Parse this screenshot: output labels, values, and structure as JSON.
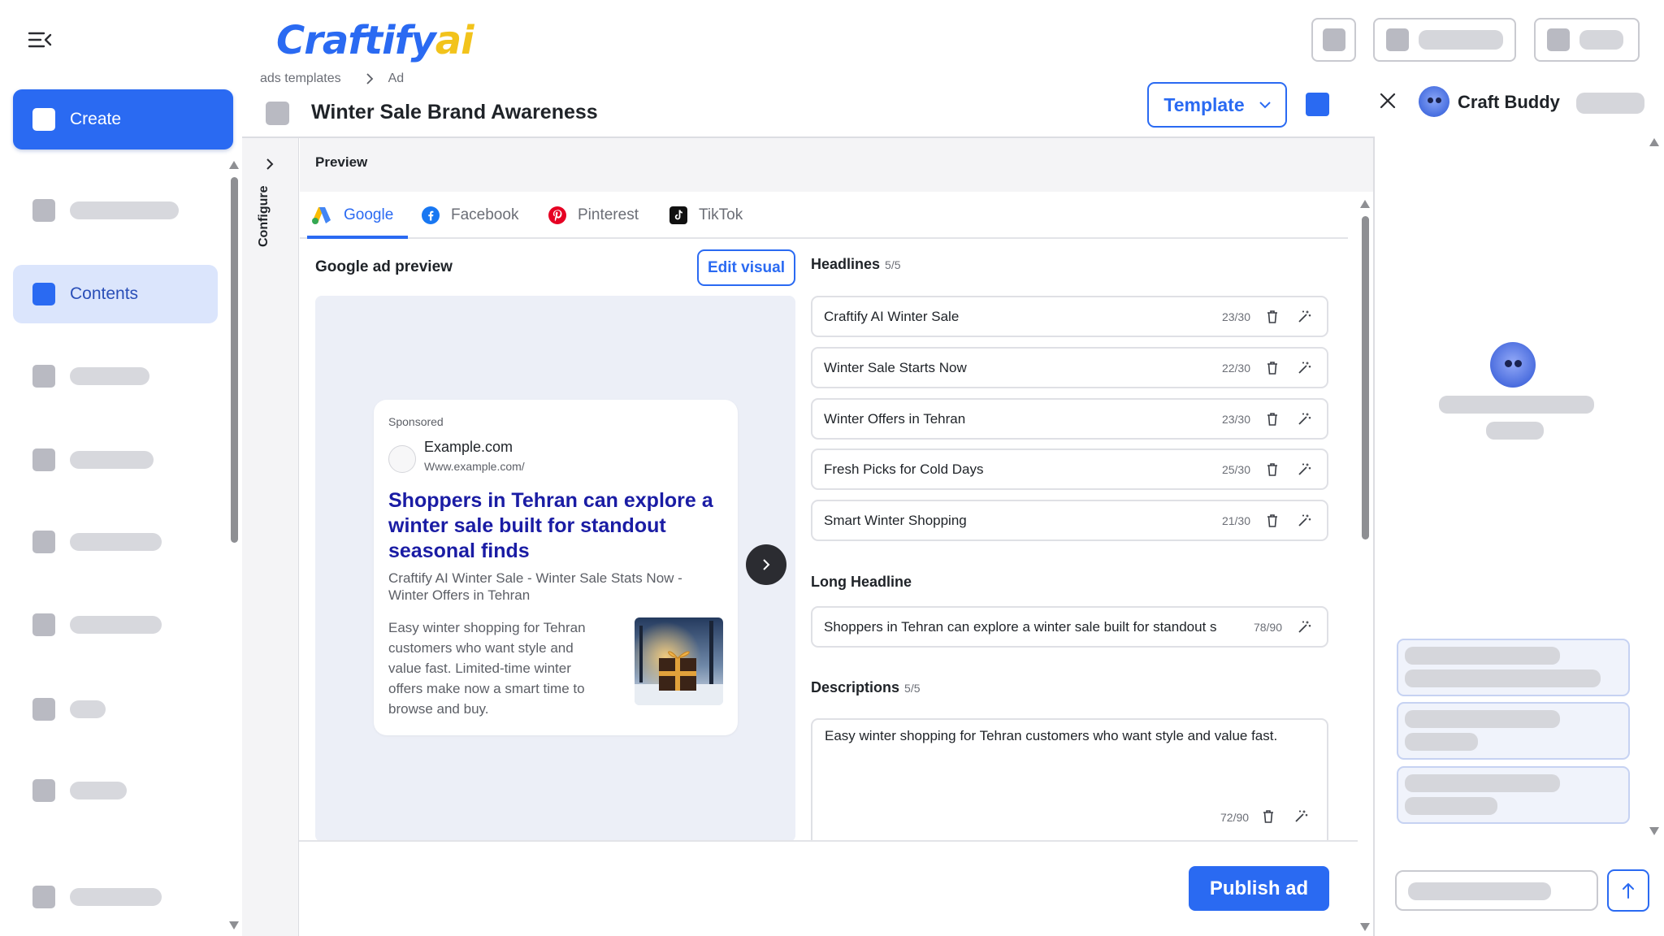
{
  "app": {
    "logo_main": "Craftify",
    "logo_accent": "ai"
  },
  "colors": {
    "accent": "#2a6af2",
    "logo_yellow": "#f2c31b",
    "headline_link": "#1a1ca4"
  },
  "sidebar": {
    "create_label": "Create",
    "contents_label": "Contents"
  },
  "breadcrumb": {
    "items": [
      "ads templates",
      "Ad"
    ]
  },
  "header": {
    "title": "Winter Sale Brand Awareness",
    "template_label": "Template"
  },
  "panel": {
    "configure_label": "Configure",
    "preview_label": "Preview",
    "tabs": [
      {
        "label": "Google",
        "icon": "google-ads-icon"
      },
      {
        "label": "Facebook",
        "icon": "facebook-icon"
      },
      {
        "label": "Pinterest",
        "icon": "pinterest-icon"
      },
      {
        "label": "TikTok",
        "icon": "tiktok-icon"
      }
    ]
  },
  "ad_preview": {
    "title": "Google ad preview",
    "edit_visual_label": "Edit visual",
    "sponsored": "Sponsored",
    "domain": "Example.com",
    "url": "Www.example.com/",
    "headline": "Shoppers in Tehran can explore a winter sale built for standout seasonal finds",
    "subline": "Craftify AI Winter Sale - Winter Sale Stats Now - Winter Offers in Tehran",
    "description": "Easy winter shopping for Tehran customers who want style and value fast. Limited-time winter offers make now a smart time to browse and buy."
  },
  "headlines": {
    "label": "Headlines",
    "count": "5/5",
    "items": [
      {
        "text": "Craftify AI Winter Sale",
        "count": "23/30"
      },
      {
        "text": "Winter Sale Starts Now",
        "count": "22/30"
      },
      {
        "text": "Winter Offers in Tehran",
        "count": "23/30"
      },
      {
        "text": "Fresh Picks for Cold Days",
        "count": "25/30"
      },
      {
        "text": "Smart Winter Shopping",
        "count": "21/30"
      }
    ]
  },
  "long_headline": {
    "label": "Long Headline",
    "text": "Shoppers in Tehran can explore a winter sale built for standout s",
    "count": "78/90"
  },
  "descriptions": {
    "label": "Descriptions",
    "count": "5/5",
    "first_text": "Easy winter shopping for Tehran customers who want style and value fast.",
    "first_count": "72/90"
  },
  "footer": {
    "publish_label": "Publish ad"
  },
  "buddy": {
    "title": "Craft Buddy"
  }
}
